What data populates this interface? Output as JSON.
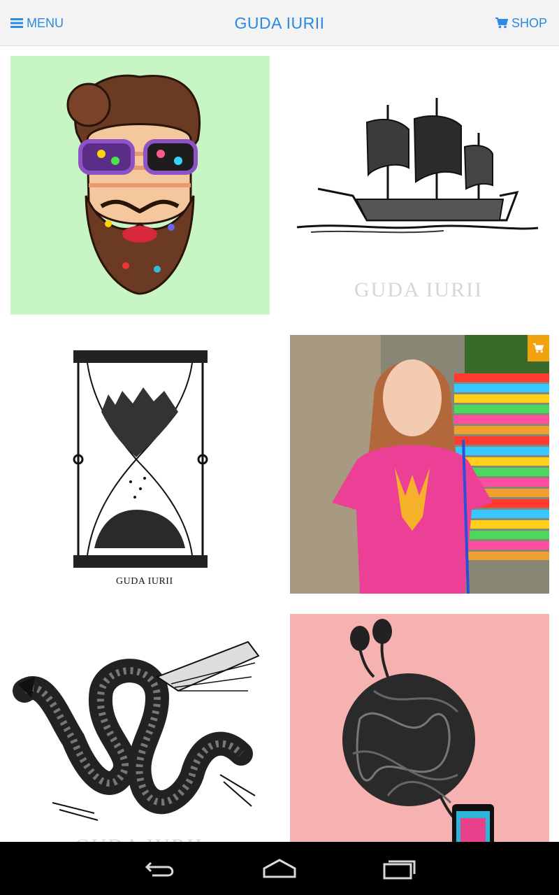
{
  "header": {
    "menu_label": "MENU",
    "title": "GUDA IURII",
    "shop_label": "SHOP"
  },
  "gallery": {
    "items": [
      {
        "name": "bearded-man-with-sunglasses",
        "bg": "#c7f5c3"
      },
      {
        "name": "galleon-ship",
        "bg": "#ffffff",
        "watermark": "GUDA IURII"
      },
      {
        "name": "hourglass-city-forest",
        "bg": "#ffffff",
        "signature": "GUDA IURII"
      },
      {
        "name": "woman-pink-tshirt-trident",
        "bg": "#6b6b5c",
        "in_shop": true
      },
      {
        "name": "serpent-dragon",
        "bg": "#ffffff",
        "watermark": "GUDA IURII"
      },
      {
        "name": "tangled-earphones-ball",
        "bg": "#f6b1b1"
      }
    ]
  },
  "colors": {
    "accent": "#2a8ae5",
    "cart_badge": "#f2a20f"
  },
  "system_nav": {
    "back": "back-icon",
    "home": "home-icon",
    "recents": "recents-icon"
  }
}
